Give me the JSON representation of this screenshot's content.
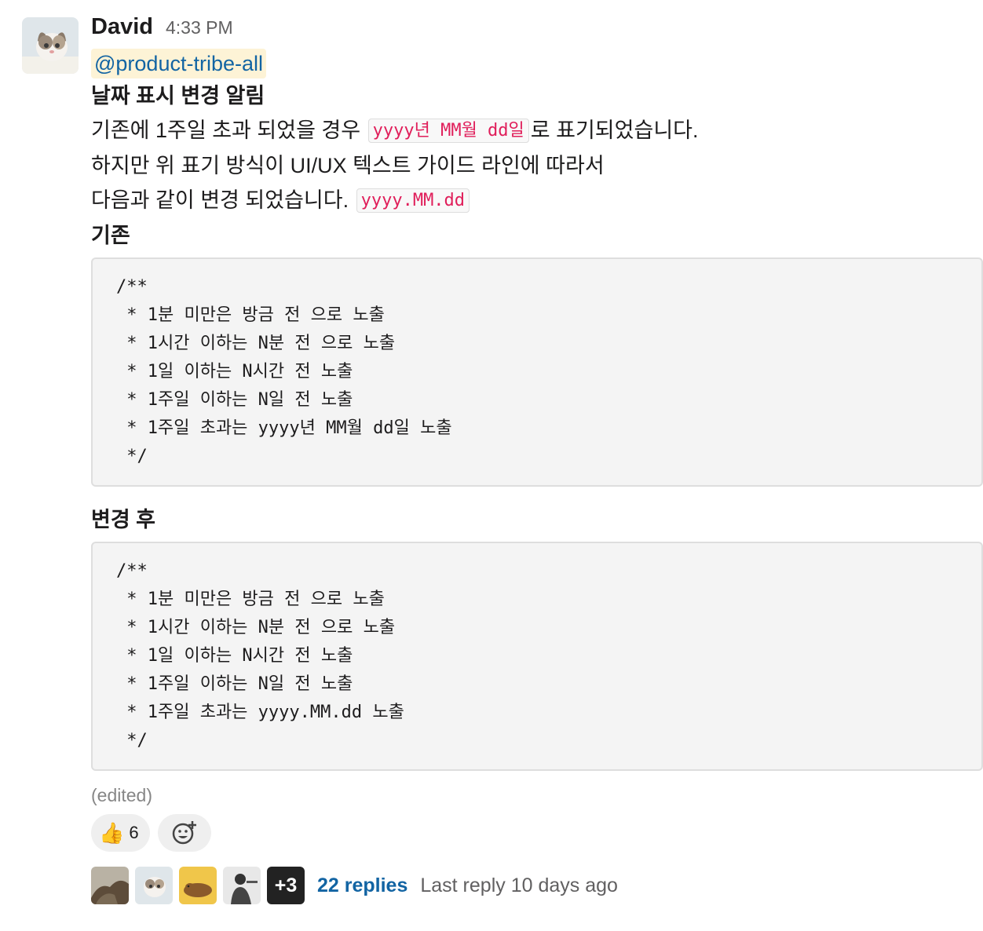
{
  "message": {
    "author": "David",
    "time": "4:33 PM",
    "mention": "@product-tribe-all",
    "title": "날짜 표시 변경 알림",
    "line1_before": "기존에 1주일 초과 되었을 경우 ",
    "line1_code": "yyyy년 MM월 dd일",
    "line1_after": "로 표기되었습니다.",
    "line2": "하지만 위 표기 방식이 UI/UX 텍스트 가이드 라인에 따라서",
    "line3_before": "다음과 같이 변경 되었습니다. ",
    "line3_code": "yyyy.MM.dd",
    "before_label": "기존",
    "before_code": "/**\n * 1분 미만은 방금 전 으로 노출\n * 1시간 이하는 N분 전 으로 노출\n * 1일 이하는 N시간 전 노출\n * 1주일 이하는 N일 전 노출\n * 1주일 초과는 yyyy년 MM월 dd일 노출\n */",
    "after_label": "변경 후",
    "after_code": "/**\n * 1분 미만은 방금 전 으로 노출\n * 1시간 이하는 N분 전 으로 노출\n * 1일 이하는 N시간 전 노출\n * 1주일 이하는 N일 전 노출\n * 1주일 초과는 yyyy.MM.dd 노출\n */",
    "edited": "(edited)"
  },
  "reactions": [
    {
      "emoji": "👍",
      "count": "6",
      "icon": "thumbs-up-icon"
    }
  ],
  "add_reaction_icon": "add-reaction-icon",
  "thread": {
    "more_count": "+3",
    "replies": "22 replies",
    "last_reply": "Last reply 10 days ago"
  },
  "colors": {
    "link": "#1264a3",
    "code": "#e01e5a",
    "mention_bg": "#fdf3d6"
  }
}
